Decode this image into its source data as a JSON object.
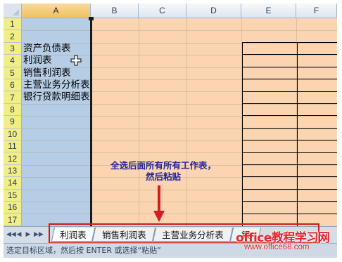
{
  "columns": [
    "A",
    "B",
    "C",
    "D",
    "E",
    "F"
  ],
  "rows": [
    "1",
    "2",
    "3",
    "4",
    "5",
    "6",
    "7",
    "8",
    "9",
    "10",
    "11",
    "12",
    "13",
    "14",
    "15",
    "16",
    "17"
  ],
  "column_a_cells": [
    "资产负债表",
    "利润表",
    "销售利润表",
    "主营业务分析表",
    "银行贷款明细表"
  ],
  "callout": {
    "line1": "全选后面所有所有工作表，",
    "line2": "然后粘贴"
  },
  "sheet_tabs": [
    "利润表",
    "销售利润表",
    "主营业务分析表",
    "银"
  ],
  "nav_buttons": [
    "◀◀",
    "◀",
    "▶",
    "▶▶"
  ],
  "status_text": "选定目标区域，然后按 ENTER 或选择“粘贴”",
  "watermark": {
    "brand": "office教程学习网",
    "url": "www.office68.com"
  },
  "colors": {
    "column_a_fill": "#b6cde6",
    "range_fill": "#fbd4b2",
    "row_header_fill": "#f1ee85",
    "selected_col_header": "#f1c15f",
    "highlight_red": "#d21a1a",
    "callout_text": "#24249c"
  }
}
